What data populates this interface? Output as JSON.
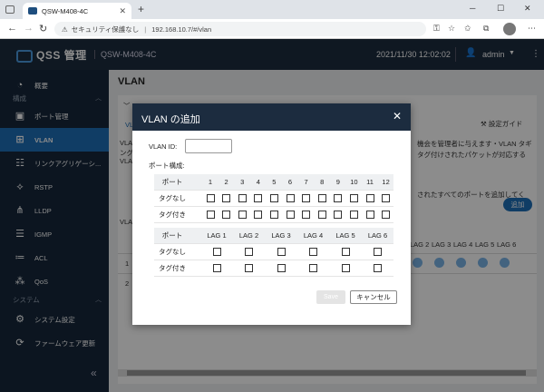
{
  "browser": {
    "tab_title": "QSW-M408-4C",
    "security_label": "セキュリティ保護なし",
    "url": "192.168.10.7/#/vlan"
  },
  "header": {
    "brand": "QSS 管理",
    "model": "QSW-M408-4C",
    "datetime": "2021/11/30  12:02:02",
    "user": "admin"
  },
  "sidebar": {
    "items": [
      {
        "label": "概要",
        "icon": "gauge-icon"
      },
      {
        "label": "ポート管理",
        "icon": "port-icon"
      },
      {
        "label": "VLAN",
        "icon": "vlan-icon",
        "active": true
      },
      {
        "label": "リンクアグリゲーシ...",
        "icon": "link-agg-icon"
      },
      {
        "label": "RSTP",
        "icon": "rstp-icon"
      },
      {
        "label": "LLDP",
        "icon": "lldp-icon"
      },
      {
        "label": "IGMP",
        "icon": "igmp-icon"
      },
      {
        "label": "ACL",
        "icon": "acl-icon"
      },
      {
        "label": "QoS",
        "icon": "qos-icon"
      },
      {
        "label": "システム設定",
        "icon": "gear-icon"
      },
      {
        "label": "ファームウェア更新",
        "icon": "firmware-icon"
      }
    ],
    "sections": {
      "config": "構成",
      "system": "システム"
    }
  },
  "main": {
    "title": "VLAN",
    "guide": "設定ガイド",
    "bg_text1": "機会を管理者に与えます・VLAN タギ",
    "bg_text2": "タグ付けされたパケットが対応する",
    "bg_text3": "されたすべてのポートを追加してく",
    "add_label": "追加",
    "bg_headers": [
      "LAG 2",
      "LAG 3",
      "LAG 4",
      "LAG 5",
      "LAG 6"
    ],
    "frag": {
      "v1": "VLAN",
      "v2": "VLAN",
      "l": "ング",
      "vl": "VLA",
      "row1": "1",
      "row2": "2",
      "tabv": "VL"
    }
  },
  "modal": {
    "title": "VLAN の追加",
    "vlan_id_label": "VLAN ID:",
    "vlan_id_value": "",
    "port_config_label": "ポート構成:",
    "port_header": "ポート",
    "ports": [
      "1",
      "2",
      "3",
      "4",
      "5",
      "6",
      "7",
      "8",
      "9",
      "10",
      "11",
      "12"
    ],
    "lags": [
      "LAG 1",
      "LAG 2",
      "LAG 3",
      "LAG 4",
      "LAG 5",
      "LAG 6"
    ],
    "untagged_label": "タグなし",
    "tagged_label": "タグ付き",
    "save_label": "Save",
    "cancel_label": "キャンセル"
  }
}
